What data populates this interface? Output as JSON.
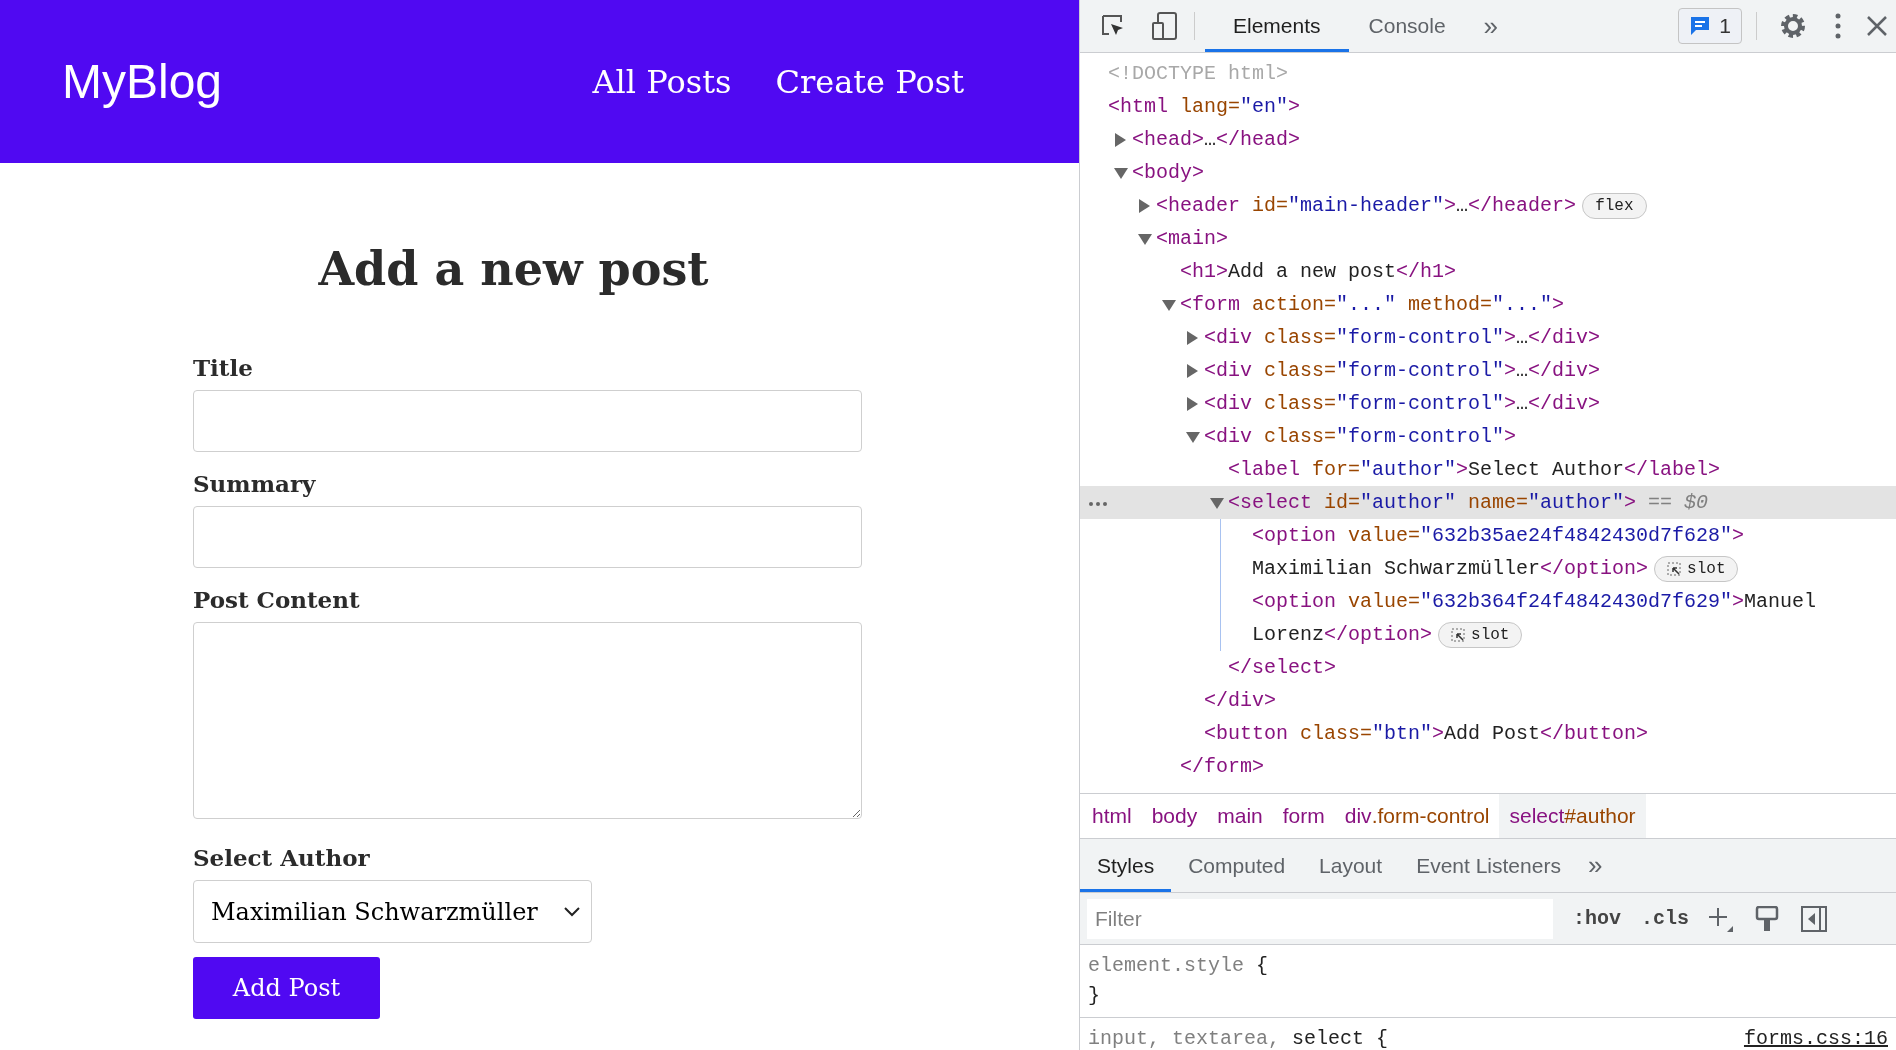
{
  "page": {
    "logo": "MyBlog",
    "nav": [
      {
        "label": "All Posts"
      },
      {
        "label": "Create Post"
      }
    ],
    "heading": "Add a new post",
    "fields": [
      {
        "label": "Title",
        "kind": "input"
      },
      {
        "label": "Summary",
        "kind": "input"
      },
      {
        "label": "Post Content",
        "kind": "textarea"
      },
      {
        "label": "Select Author",
        "kind": "select",
        "value": "Maximilian Schwarzmüller"
      }
    ],
    "submit": "Add Post"
  },
  "devtools": {
    "tabs": [
      {
        "label": "Elements",
        "selected": true
      },
      {
        "label": "Console",
        "selected": false
      }
    ],
    "more_tabs": "»",
    "issues_count": "1",
    "tree": [
      {
        "selected": false,
        "lines": [
          [
            {
              "kind": "doctype",
              "text": "<!DOCTYPE html>"
            }
          ]
        ]
      },
      {
        "selected": false,
        "lines": [
          [
            {
              "kind": "tag",
              "text": "<html "
            },
            {
              "kind": "attr",
              "text": "lang="
            },
            {
              "kind": "value",
              "text": "\"en\""
            },
            {
              "kind": "tag",
              "text": ">"
            }
          ]
        ],
        "children": [
          {
            "expanded": false,
            "selected": false,
            "lines": [
              [
                {
                  "kind": "tag",
                  "text": "<head>"
                },
                {
                  "kind": "text",
                  "text": "…"
                },
                {
                  "kind": "tag",
                  "text": "</head>"
                }
              ]
            ]
          },
          {
            "expanded": true,
            "selected": false,
            "lines": [
              [
                {
                  "kind": "tag",
                  "text": "<body>"
                }
              ]
            ],
            "children": [
              {
                "expanded": false,
                "selected": false,
                "lines": [
                  [
                    {
                      "kind": "tag",
                      "text": "<header "
                    },
                    {
                      "kind": "attr",
                      "text": "id="
                    },
                    {
                      "kind": "value",
                      "text": "\"main-header\""
                    },
                    {
                      "kind": "tag",
                      "text": ">"
                    },
                    {
                      "kind": "text",
                      "text": "…"
                    },
                    {
                      "kind": "tag",
                      "text": "</header>"
                    },
                    {
                      "kind": "badge",
                      "text": "flex"
                    }
                  ]
                ]
              },
              {
                "expanded": true,
                "selected": false,
                "lines": [
                  [
                    {
                      "kind": "tag",
                      "text": "<main>"
                    }
                  ]
                ],
                "children": [
                  {
                    "selected": false,
                    "lines": [
                      [
                        {
                          "kind": "tag",
                          "text": "<h1>"
                        },
                        {
                          "kind": "text",
                          "text": "Add a new post"
                        },
                        {
                          "kind": "tag",
                          "text": "</h1>"
                        }
                      ]
                    ]
                  },
                  {
                    "expanded": true,
                    "selected": false,
                    "lines": [
                      [
                        {
                          "kind": "tag",
                          "text": "<form "
                        },
                        {
                          "kind": "attr",
                          "text": "action="
                        },
                        {
                          "kind": "value",
                          "text": "\"...\""
                        },
                        {
                          "kind": "attr",
                          "text": " method="
                        },
                        {
                          "kind": "value",
                          "text": "\"...\""
                        },
                        {
                          "kind": "tag",
                          "text": ">"
                        }
                      ]
                    ],
                    "close": [
                      {
                        "kind": "tag",
                        "text": "</form>"
                      }
                    ],
                    "children": [
                      {
                        "expanded": false,
                        "selected": false,
                        "lines": [
                          [
                            {
                              "kind": "tag",
                              "text": "<div "
                            },
                            {
                              "kind": "attr",
                              "text": "class="
                            },
                            {
                              "kind": "value",
                              "text": "\"form-control\""
                            },
                            {
                              "kind": "tag",
                              "text": ">"
                            },
                            {
                              "kind": "text",
                              "text": "…"
                            },
                            {
                              "kind": "tag",
                              "text": "</div>"
                            }
                          ]
                        ]
                      },
                      {
                        "expanded": false,
                        "selected": false,
                        "lines": [
                          [
                            {
                              "kind": "tag",
                              "text": "<div "
                            },
                            {
                              "kind": "attr",
                              "text": "class="
                            },
                            {
                              "kind": "value",
                              "text": "\"form-control\""
                            },
                            {
                              "kind": "tag",
                              "text": ">"
                            },
                            {
                              "kind": "text",
                              "text": "…"
                            },
                            {
                              "kind": "tag",
                              "text": "</div>"
                            }
                          ]
                        ]
                      },
                      {
                        "expanded": false,
                        "selected": false,
                        "lines": [
                          [
                            {
                              "kind": "tag",
                              "text": "<div "
                            },
                            {
                              "kind": "attr",
                              "text": "class="
                            },
                            {
                              "kind": "value",
                              "text": "\"form-control\""
                            },
                            {
                              "kind": "tag",
                              "text": ">"
                            },
                            {
                              "kind": "text",
                              "text": "…"
                            },
                            {
                              "kind": "tag",
                              "text": "</div>"
                            }
                          ]
                        ]
                      },
                      {
                        "expanded": true,
                        "selected": false,
                        "lines": [
                          [
                            {
                              "kind": "tag",
                              "text": "<div "
                            },
                            {
                              "kind": "attr",
                              "text": "class="
                            },
                            {
                              "kind": "value",
                              "text": "\"form-control\""
                            },
                            {
                              "kind": "tag",
                              "text": ">"
                            }
                          ]
                        ],
                        "close": [
                          {
                            "kind": "tag",
                            "text": "</div>"
                          }
                        ],
                        "children": [
                          {
                            "selected": false,
                            "lines": [
                              [
                                {
                                  "kind": "tag",
                                  "text": "<label "
                                },
                                {
                                  "kind": "attr",
                                  "text": "for="
                                },
                                {
                                  "kind": "value",
                                  "text": "\"author\""
                                },
                                {
                                  "kind": "tag",
                                  "text": ">"
                                },
                                {
                                  "kind": "text",
                                  "text": "Select Author"
                                },
                                {
                                  "kind": "tag",
                                  "text": "</label>"
                                }
                              ]
                            ]
                          },
                          {
                            "expanded": true,
                            "selected": true,
                            "lines": [
                              [
                                {
                                  "kind": "tag",
                                  "text": "<select "
                                },
                                {
                                  "kind": "attr",
                                  "text": "id="
                                },
                                {
                                  "kind": "value",
                                  "text": "\"author\""
                                },
                                {
                                  "kind": "attr",
                                  "text": " name="
                                },
                                {
                                  "kind": "value",
                                  "text": "\"author\""
                                },
                                {
                                  "kind": "tag",
                                  "text": ">"
                                },
                                {
                                  "kind": "dim",
                                  "text": " == "
                                },
                                {
                                  "kind": "var",
                                  "text": "$0"
                                }
                              ]
                            ],
                            "close": [
                              {
                                "kind": "tag",
                                "text": "</select>"
                              }
                            ],
                            "children": [
                              {
                                "selected": false,
                                "lines": [
                                  [
                                    {
                                      "kind": "tag",
                                      "text": "<option "
                                    },
                                    {
                                      "kind": "attr",
                                      "text": "value="
                                    },
                                    {
                                      "kind": "value",
                                      "text": "\"632b35ae24f4842430d7f628\""
                                    },
                                    {
                                      "kind": "tag",
                                      "text": ">"
                                    }
                                  ],
                                  [
                                    {
                                      "kind": "text",
                                      "text": "Maximilian Schwarzmüller"
                                    },
                                    {
                                      "kind": "tag",
                                      "text": "</option>"
                                    },
                                    {
                                      "kind": "slot",
                                      "text": "slot"
                                    }
                                  ]
                                ]
                              },
                              {
                                "selected": false,
                                "lines": [
                                  [
                                    {
                                      "kind": "tag",
                                      "text": "<option "
                                    },
                                    {
                                      "kind": "attr",
                                      "text": "value="
                                    },
                                    {
                                      "kind": "value",
                                      "text": "\"632b364f24f4842430d7f629\""
                                    },
                                    {
                                      "kind": "tag",
                                      "text": ">"
                                    },
                                    {
                                      "kind": "text",
                                      "text": "Manuel"
                                    }
                                  ],
                                  [
                                    {
                                      "kind": "text",
                                      "text": "Lorenz"
                                    },
                                    {
                                      "kind": "tag",
                                      "text": "</option>"
                                    },
                                    {
                                      "kind": "slot",
                                      "text": "slot"
                                    }
                                  ]
                                ]
                              }
                            ]
                          }
                        ]
                      },
                      {
                        "selected": false,
                        "lines": [
                          [
                            {
                              "kind": "tag",
                              "text": "<button "
                            },
                            {
                              "kind": "attr",
                              "text": "class="
                            },
                            {
                              "kind": "value",
                              "text": "\"btn\""
                            },
                            {
                              "kind": "tag",
                              "text": ">"
                            },
                            {
                              "kind": "text",
                              "text": "Add Post"
                            },
                            {
                              "kind": "tag",
                              "text": "</button>"
                            }
                          ]
                        ]
                      }
                    ]
                  }
                ]
              }
            ]
          }
        ]
      }
    ],
    "breadcrumbs": [
      {
        "name": "html",
        "selected": false
      },
      {
        "name": "body",
        "selected": false
      },
      {
        "name": "main",
        "selected": false
      },
      {
        "name": "form",
        "selected": false
      },
      {
        "name": "div",
        "suffix": ".form-control",
        "selected": false
      },
      {
        "name": "select",
        "suffix": "#author",
        "selected": true
      }
    ],
    "subtabs": [
      {
        "label": "Styles",
        "selected": true
      },
      {
        "label": "Computed",
        "selected": false
      },
      {
        "label": "Layout",
        "selected": false
      },
      {
        "label": "Event Listeners",
        "selected": false
      }
    ],
    "more_subtabs": "»",
    "filter": {
      "placeholder": "Filter"
    },
    "hov": ":hov",
    "cls": ".cls",
    "rules": [
      {
        "selectors": [
          {
            "text": "element.style",
            "matched": false
          }
        ],
        "open": " {",
        "close": "}"
      },
      {
        "selectors": [
          {
            "text": "input, ",
            "matched": false
          },
          {
            "text": "textarea, ",
            "matched": false
          },
          {
            "text": "select",
            "matched": true
          }
        ],
        "open": " {",
        "source": "forms.css:16"
      }
    ]
  }
}
